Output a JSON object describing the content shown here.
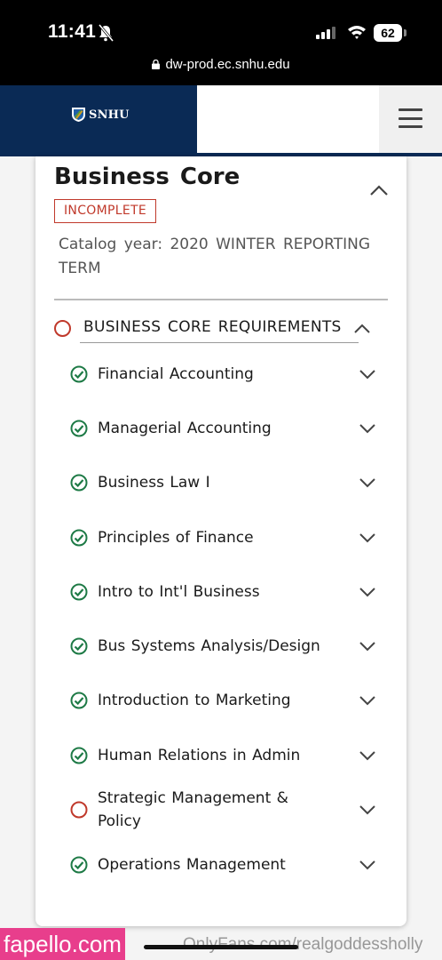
{
  "status_bar": {
    "time": "11:41",
    "battery": "62",
    "url": "dw-prod.ec.snhu.edu"
  },
  "header": {
    "logo_text": "SNHU",
    "brand_color": "#0a2a55"
  },
  "card": {
    "title": "Business Core",
    "status_badge": "INCOMPLETE",
    "catalog_year": "Catalog year:  2020 WINTER REPORTING TERM",
    "requirement": {
      "label": "BUSINESS CORE REQUIREMENTS",
      "status": "incomplete"
    },
    "courses": [
      {
        "title": "Financial Accounting",
        "status": "complete"
      },
      {
        "title": "Managerial Accounting",
        "status": "complete"
      },
      {
        "title": "Business Law I",
        "status": "complete"
      },
      {
        "title": "Principles of Finance",
        "status": "complete"
      },
      {
        "title": "Intro to Int'l Business",
        "status": "complete"
      },
      {
        "title": "Bus Systems Analysis/Design",
        "status": "complete"
      },
      {
        "title": "Introduction to Marketing",
        "status": "complete"
      },
      {
        "title": "Human Relations in Admin",
        "status": "complete"
      },
      {
        "title": "Strategic Management & Policy",
        "status": "incomplete"
      },
      {
        "title": "Operations Management",
        "status": "complete"
      }
    ]
  },
  "colors": {
    "complete": "#1e7a46",
    "incomplete": "#c0392b"
  },
  "watermarks": {
    "left": "fapello.com",
    "right": "OnlyFans.com/realgoddessholly"
  }
}
